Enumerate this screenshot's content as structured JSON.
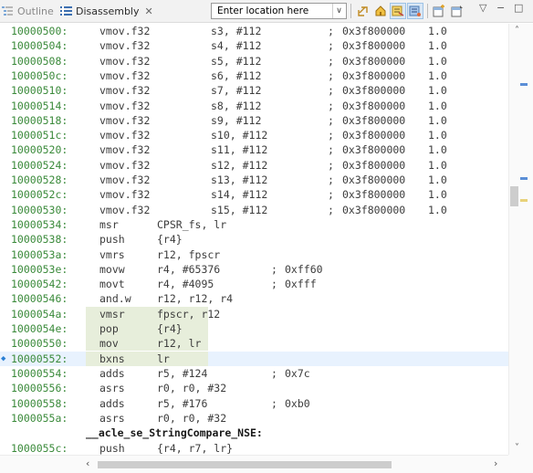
{
  "toolbar": {
    "outline_tab": "Outline",
    "disassembly_tab": "Disassembly",
    "close_glyph": "✕",
    "location_placeholder": "Enter location here",
    "dropdown_glyph": "∨",
    "window_controls": [
      "▽",
      "−",
      "□"
    ]
  },
  "listing": {
    "asm_rows": [
      {
        "addr": "10000500:",
        "mnem": "vmov.f32",
        "ops": "s3, #112",
        "cmt": ";",
        "hex": "0x3f800000",
        "fval": "1.0"
      },
      {
        "addr": "10000504:",
        "mnem": "vmov.f32",
        "ops": "s4, #112",
        "cmt": ";",
        "hex": "0x3f800000",
        "fval": "1.0"
      },
      {
        "addr": "10000508:",
        "mnem": "vmov.f32",
        "ops": "s5, #112",
        "cmt": ";",
        "hex": "0x3f800000",
        "fval": "1.0"
      },
      {
        "addr": "1000050c:",
        "mnem": "vmov.f32",
        "ops": "s6, #112",
        "cmt": ";",
        "hex": "0x3f800000",
        "fval": "1.0"
      },
      {
        "addr": "10000510:",
        "mnem": "vmov.f32",
        "ops": "s7, #112",
        "cmt": ";",
        "hex": "0x3f800000",
        "fval": "1.0"
      },
      {
        "addr": "10000514:",
        "mnem": "vmov.f32",
        "ops": "s8, #112",
        "cmt": ";",
        "hex": "0x3f800000",
        "fval": "1.0"
      },
      {
        "addr": "10000518:",
        "mnem": "vmov.f32",
        "ops": "s9, #112",
        "cmt": ";",
        "hex": "0x3f800000",
        "fval": "1.0"
      },
      {
        "addr": "1000051c:",
        "mnem": "vmov.f32",
        "ops": "s10, #112",
        "cmt": ";",
        "hex": "0x3f800000",
        "fval": "1.0"
      },
      {
        "addr": "10000520:",
        "mnem": "vmov.f32",
        "ops": "s11, #112",
        "cmt": ";",
        "hex": "0x3f800000",
        "fval": "1.0"
      },
      {
        "addr": "10000524:",
        "mnem": "vmov.f32",
        "ops": "s12, #112",
        "cmt": ";",
        "hex": "0x3f800000",
        "fval": "1.0"
      },
      {
        "addr": "10000528:",
        "mnem": "vmov.f32",
        "ops": "s13, #112",
        "cmt": ";",
        "hex": "0x3f800000",
        "fval": "1.0"
      },
      {
        "addr": "1000052c:",
        "mnem": "vmov.f32",
        "ops": "s14, #112",
        "cmt": ";",
        "hex": "0x3f800000",
        "fval": "1.0"
      },
      {
        "addr": "10000530:",
        "mnem": "vmov.f32",
        "ops": "s15, #112",
        "cmt": ";",
        "hex": "0x3f800000",
        "fval": "1.0"
      },
      {
        "addr": "10000534:",
        "mnem": "msr",
        "ops": "CPSR_fs, lr"
      },
      {
        "addr": "10000538:",
        "mnem": "push",
        "ops": "{r4}"
      },
      {
        "addr": "1000053a:",
        "mnem": "vmrs",
        "ops": "r12, fpscr"
      },
      {
        "addr": "1000053e:",
        "mnem": "movw",
        "ops": "r4, #65376",
        "cmt": ";",
        "hex": "0xff60"
      },
      {
        "addr": "10000542:",
        "mnem": "movt",
        "ops": "r4, #4095",
        "cmt": ";",
        "hex": "0xfff"
      },
      {
        "addr": "10000546:",
        "mnem": "and.w",
        "ops": "r12, r12, r4"
      },
      {
        "addr": "1000054a:",
        "mnem": "vmsr",
        "ops": "fpscr, r12",
        "highlight": true
      },
      {
        "addr": "1000054e:",
        "mnem": "pop",
        "ops": "{r4}",
        "highlight": true
      },
      {
        "addr": "10000550:",
        "mnem": "mov",
        "ops": "r12, lr",
        "highlight": true
      },
      {
        "addr": "10000552:",
        "mnem": "bxns",
        "ops": "lr",
        "highlight": true,
        "current": true
      },
      {
        "addr": "10000554:",
        "mnem": "adds",
        "ops": "r5, #124",
        "cmt": ";",
        "hex": "0x7c"
      },
      {
        "addr": "10000556:",
        "mnem": "asrs",
        "ops": "r0, r0, #32"
      },
      {
        "addr": "10000558:",
        "mnem": "adds",
        "ops": "r5, #176",
        "cmt": ";",
        "hex": "0xb0"
      },
      {
        "addr": "1000055a:",
        "mnem": "asrs",
        "ops": "r0, r0, #32"
      }
    ],
    "function_label": "__acle_se_StringCompare_NSE:",
    "partial_row": {
      "addr": "1000055c:",
      "mnem": "push",
      "ops": "{r4, r7, lr}"
    },
    "current_arrow": "◆"
  },
  "scroll": {
    "up": "˄",
    "down": "˅",
    "left": "‹",
    "right": "›"
  },
  "colors": {
    "address": "#3a8a3a",
    "current_line_bg": "#e8f2fe",
    "highlight_bg": "#e7eedb"
  }
}
